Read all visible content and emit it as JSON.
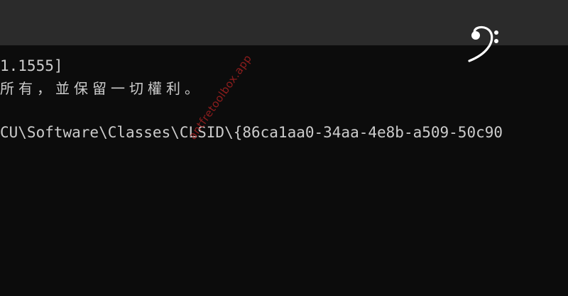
{
  "terminal": {
    "lines": [
      "1.1555]",
      "所有，並保留一切權利。",
      "CU\\Software\\Classes\\CLSID\\{86ca1aa0-34aa-4e8b-a509-50c90"
    ]
  },
  "watermark": {
    "text": "antfretoolbox.app"
  },
  "logo": {
    "icon": "bass-clef-icon"
  },
  "colors": {
    "titlebar": "#2b2b2b",
    "background": "#0c0c0c",
    "text": "#cccccc",
    "watermark": "#a32020"
  }
}
